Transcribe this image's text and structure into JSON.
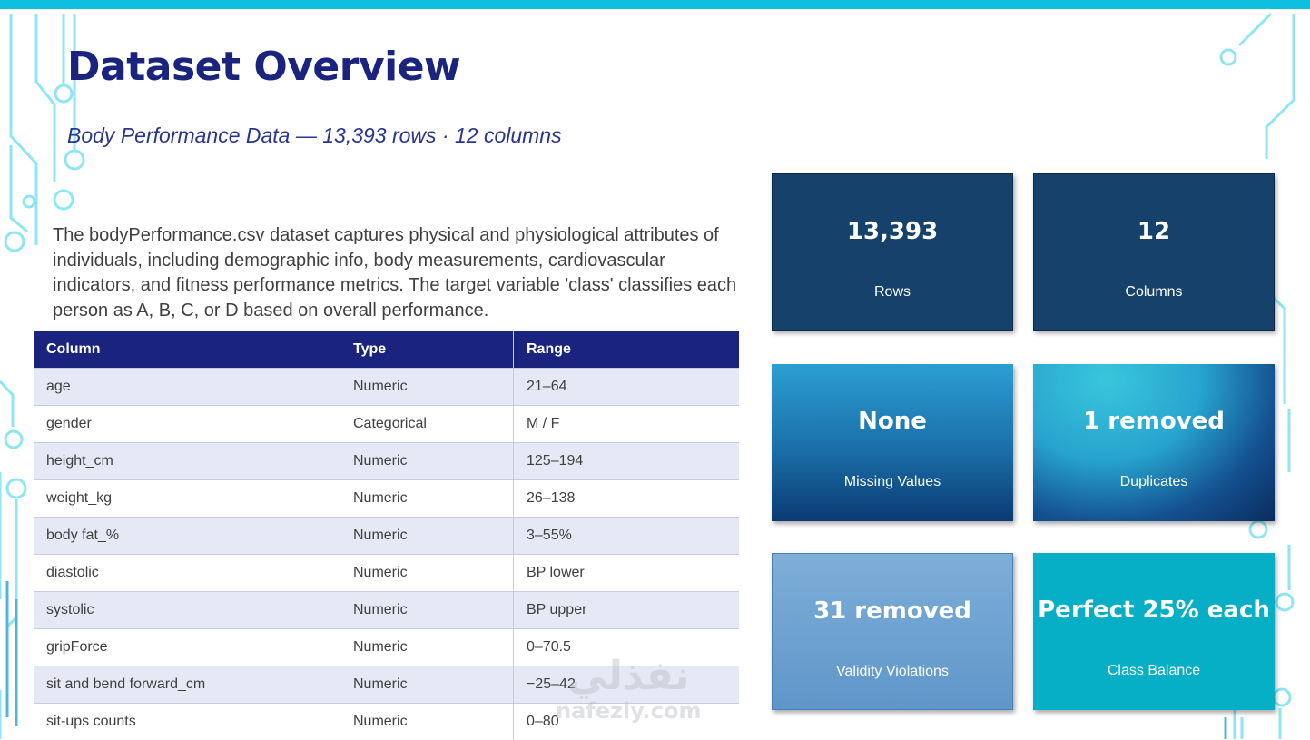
{
  "slide": {
    "title": "Dataset Overview",
    "subtitle": "Body Performance Data — 13,393 rows · 12 columns",
    "description": "The bodyPerformance.csv dataset captures physical and physiological attributes of individuals, including demographic info, body measurements, cardiovascular indicators, and fitness performance metrics. The target variable 'class' classifies each person as A, B, C, or D based on overall performance."
  },
  "table": {
    "headers": [
      "Column",
      "Type",
      "Range"
    ],
    "rows": [
      [
        "age",
        "Numeric",
        "21–64"
      ],
      [
        "gender",
        "Categorical",
        "M / F"
      ],
      [
        "height_cm",
        "Numeric",
        "125–194"
      ],
      [
        "weight_kg",
        "Numeric",
        "26–138"
      ],
      [
        "body fat_%",
        "Numeric",
        "3–55%"
      ],
      [
        "diastolic",
        "Numeric",
        "BP lower"
      ],
      [
        "systolic",
        "Numeric",
        "BP upper"
      ],
      [
        "gripForce",
        "Numeric",
        "0–70.5"
      ],
      [
        "sit and bend forward_cm",
        "Numeric",
        "−25–42"
      ],
      [
        "sit-ups counts",
        "Numeric",
        "0–80"
      ]
    ]
  },
  "cards": [
    {
      "value": "13,393",
      "label": "Rows"
    },
    {
      "value": "12",
      "label": "Columns"
    },
    {
      "value": "None",
      "label": "Missing Values"
    },
    {
      "value": "1 removed",
      "label": "Duplicates"
    },
    {
      "value": "31 removed",
      "label": "Validity Violations"
    },
    {
      "value": "Perfect 25% each",
      "label": "Class Balance"
    }
  ],
  "watermark": {
    "arabic": "نفذلي",
    "latin": "nafezly.com"
  },
  "colors": {
    "accent_bar": "#0ebfe0",
    "title": "#1a237e",
    "table_header": "#1a237e",
    "table_stripe": "#e6e9f5",
    "circuit": "#8fe6f2"
  }
}
